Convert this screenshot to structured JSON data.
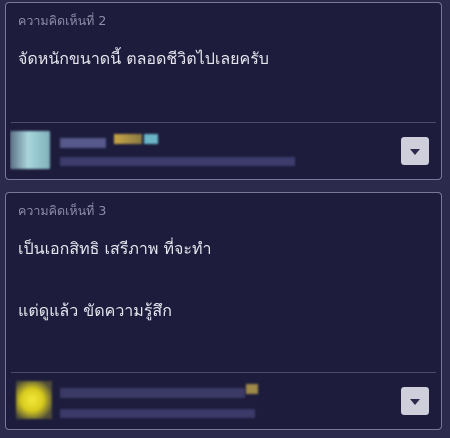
{
  "comments": [
    {
      "number_label": "ความคิดเห็นที่ 2",
      "lines": [
        "จัดหนักขนาดนี้ ตลอดชีวิตไปเลยครับ"
      ],
      "author": {
        "avatar": "pixelated-avatar",
        "name": "",
        "date": ""
      },
      "menu_icon": "chevron-down-icon"
    },
    {
      "number_label": "ความคิดเห็นที่ 3",
      "lines": [
        "เป็นเอกสิทธิ เสรีภาพ ที่จะทำ",
        "",
        "แต่ดูแล้ว ขัดความรู้สึก"
      ],
      "author": {
        "avatar": "pixelated-avatar",
        "name": "",
        "date": ""
      },
      "menu_icon": "chevron-down-icon"
    }
  ],
  "colors": {
    "page_background": "#2b2a4c",
    "card_background": "#1d1c3c",
    "card_border": "#7a7898",
    "meta_text": "#8f8da8",
    "body_text": "#e6e6ee",
    "button_background": "#cfcfdc"
  }
}
